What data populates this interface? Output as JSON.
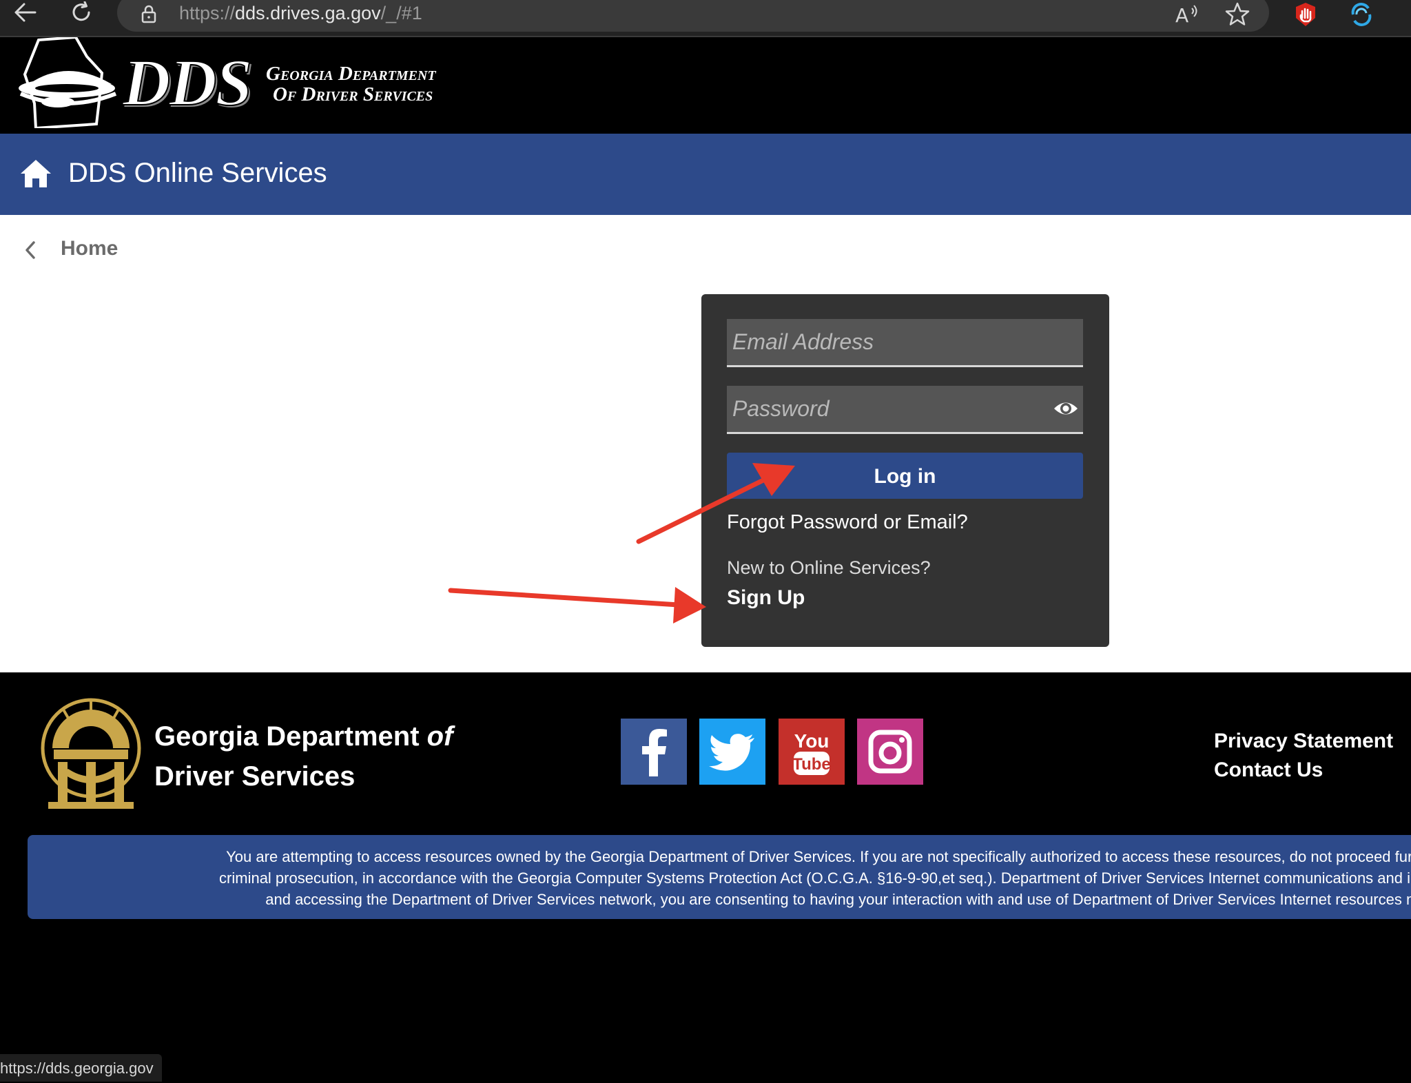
{
  "browser": {
    "url_prefix": "https://",
    "url_host": "dds.drives.ga.gov",
    "url_path": "/_/#1",
    "status_url": "https://dds.georgia.gov"
  },
  "header": {
    "logo_text": "DDS",
    "org_line1": "Georgia Department",
    "org_line2": "Of Driver Services"
  },
  "nav": {
    "title": "DDS Online Services",
    "breadcrumb": "Home"
  },
  "login": {
    "email_placeholder": "Email Address",
    "password_placeholder": "Password",
    "login_label": "Log in",
    "forgot_label": "Forgot Password or Email?",
    "new_prompt": "New to Online Services?",
    "signup_label": "Sign Up"
  },
  "footer": {
    "name_part1": "Georgia Department ",
    "name_of": "of",
    "name_line2": "Driver Services",
    "links": [
      "Privacy Statement",
      "Contact Us"
    ],
    "warning_lines": [
      "You are attempting to access resources owned by the Georgia Department of Driver Services. If you are not specifically authorized to access these resources, do not proceed further. Unau",
      "criminal prosecution, in accordance with the Georgia Computer Systems Protection Act (O.C.G.A. §16-9-90,et seq.). Department of Driver Services Internet communications and interaction a",
      "and accessing the Department of Driver Services network, you are consenting to having your interaction with and use of Department of Driver Services Internet resources monit"
    ]
  },
  "colors": {
    "brand_blue": "#2d4a8a",
    "card_bg": "#333333",
    "annotation_red": "#e8392a",
    "facebook": "#3b5998",
    "twitter": "#1da1f2",
    "youtube": "#c4302b",
    "instagram": "#c13584"
  },
  "icons": [
    "back-arrow-icon",
    "reload-icon",
    "lock-icon",
    "read-aloud-icon",
    "favorite-star-icon",
    "extension-icon",
    "home-icon",
    "chevron-left-icon",
    "eye-icon",
    "facebook-icon",
    "twitter-icon",
    "youtube-icon",
    "instagram-icon"
  ]
}
